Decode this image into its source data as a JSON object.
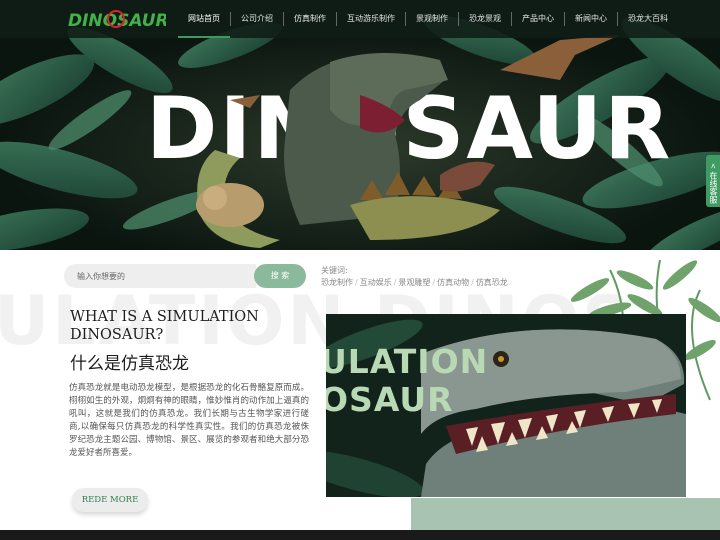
{
  "header": {
    "logo_text": "DINOSAUR",
    "nav": [
      {
        "label": "网站首页",
        "active": true
      },
      {
        "label": "公司介绍"
      },
      {
        "label": "仿真制作"
      },
      {
        "label": "互动游乐制作"
      },
      {
        "label": "景观制作"
      },
      {
        "label": "恐龙景观"
      },
      {
        "label": "产品中心"
      },
      {
        "label": "新闻中心"
      },
      {
        "label": "恐龙大百科"
      }
    ]
  },
  "hero": {
    "title": "DINOSAUR"
  },
  "side_tab": {
    "label": "在线客服",
    "arrow": "<"
  },
  "search": {
    "placeholder": "输入你想要的",
    "button_label": "搜 索"
  },
  "keywords": {
    "label": "关键词:",
    "items": [
      "恐龙制作",
      "互动娱乐",
      "景观雕塑",
      "仿真动物",
      "仿真恐龙"
    ]
  },
  "intro": {
    "watermark": "ULATION DINOS",
    "title_en": "WHAT IS A SIMULATION DINOSAUR?",
    "title_cn": "什么是仿真恐龙",
    "description": "仿真恐龙就是电动恐龙模型，是根据恐龙的化石骨骼复原而成。栩栩如生的外观，炯炯有神的眼睛，惟妙惟肖的动作加上逼真的吼叫，这就是我们的仿真恐龙。我们长期与古生物学家进行磋商,以确保每只仿真恐龙的科学性真实性。我们的仿真恐龙被侏罗纪恐龙主题公园、博物馆、景区、展览的参观者和绝大部分恐龙爱好者所喜爱。",
    "more_label": "REDE MORE",
    "image_title_line1": "ULATION",
    "image_title_line2": "OSAUR"
  },
  "colors": {
    "accent_green": "#3f9b62",
    "button_green": "#8ab99c",
    "block_green": "#a8c3b1",
    "logo_red": "#d8232a",
    "logo_green": "#43b04a"
  }
}
